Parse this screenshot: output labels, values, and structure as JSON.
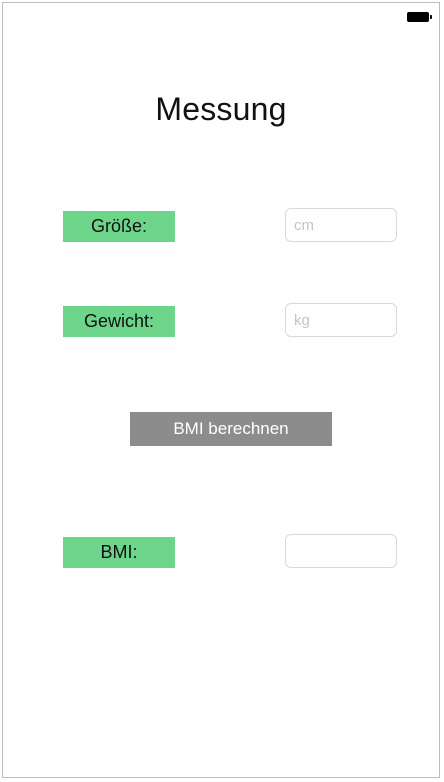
{
  "title": "Messung",
  "fields": {
    "height_label": "Größe:",
    "height_value": "",
    "height_placeholder": "cm",
    "weight_label": "Gewicht:",
    "weight_value": "",
    "weight_placeholder": "kg",
    "bmi_label": "BMI:",
    "bmi_value": ""
  },
  "button": {
    "calculate_label": "BMI berechnen"
  },
  "icons": {
    "status": "battery-icon"
  },
  "colors": {
    "label_background": "#6cd58a",
    "button_background": "#8c8c8c",
    "button_text": "#ffffff"
  }
}
